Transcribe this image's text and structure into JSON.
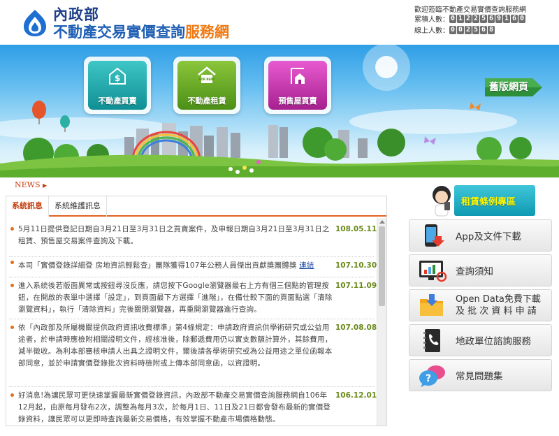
{
  "header": {
    "ministry": "內政部",
    "title_part1": "不動產交易實價查詢",
    "title_part2": "服務網",
    "welcome": "歡迎蒞臨不動產交易實價查詢服務網",
    "visits_label": "累積人數：",
    "visits_digits": [
      "0",
      "1",
      "2",
      "2",
      "5",
      "6",
      "9",
      "1",
      "6",
      "0"
    ],
    "online_label": "線上人數：",
    "online_digits": [
      "0",
      "0",
      "2",
      "5",
      "6",
      "8"
    ]
  },
  "banner": {
    "tiles": {
      "buy": "不動產買賣",
      "rent": "不動產租賃",
      "presale": "預售屋買賣"
    },
    "old_site": "舊版網頁",
    "rent_icon_text": "FOR RENT"
  },
  "news": {
    "label": "NEWS",
    "tabs": [
      "系統訊息",
      "系統維護訊息"
    ],
    "items": [
      {
        "text": "5月11日提供登記日期自3月21日至3月31日之買賣案件，及申報日期自3月21日至3月31日之租賃、預售屋交易案件查詢及下載。",
        "date": "108.05.11",
        "more": ""
      },
      {
        "text": "本司「實價登錄詳細登 房地資訊輕鬆查」團隊獲得107年公務人員傑出貢獻獎團體獎 ",
        "date": "107.10.30",
        "more": "連結"
      },
      {
        "text": "進入系統後若版面異常或按鈕尋沒反應，請您按下Google瀏覽器最右上方有個三個點的管理按鈕，在開啟的表單中選擇「設定」，到頁面最下方選擇「進階」，在備仕較下面的頁面點選「清除瀏覽資料」，執行「清除資料」完後關閉瀏覽器，再重開瀏覽器進行查詢。",
        "date": "107.11.09",
        "more": ""
      },
      {
        "text": "依「內政部及所屬機關提供政府資訊收費標準」第4條規定：申請政府資訊供學術研究或公益用途者，於申請時應檢附相關證明文件，經核准後，除郵遞費用仍以實支數額計算外，其餘費用，減半徵收。為利本部審核申請人出具之證明文件，爾後請各學術研究或為公益用途之單位函報本部同意，並於申請實價登錄批次資料時檢附或上傳本部同意函，以資證明。",
        "date": "107.08.08",
        "more": ""
      },
      {
        "text": "好消息!為讓民眾可更快速掌握最新實價登錄資訊，內政部不動產交易實價查詢服務網自106年12月起，由原每月發布2次，調整為每月3次，於每月1日、11日及21日都會發布最新的實價登錄資料，讓民眾可以更即時查詢最新交易價格，有效掌握不動產市場價格動態。",
        "date": "106.12.01",
        "more": ""
      }
    ]
  },
  "sidebar": {
    "rent_cases": "租賃條例專區",
    "buttons": [
      {
        "label": "App及文件下載",
        "icon": "app-download-icon"
      },
      {
        "label": "查詢須知",
        "icon": "monitor-chart-icon"
      },
      {
        "label_line1": "Open Data免費下載",
        "label_line2": "及 批 次 資 料 申 請",
        "icon": "folder-download-icon"
      },
      {
        "label": "地政單位諮詢服務",
        "icon": "phone-book-icon"
      },
      {
        "label": "常見問題集",
        "icon": "question-bubbles-icon"
      }
    ]
  },
  "colors": {
    "accent": "#e1621e",
    "title_blue": "#1f5fb4",
    "title_orange": "#f07a14",
    "date_green": "#6a8a1a"
  }
}
